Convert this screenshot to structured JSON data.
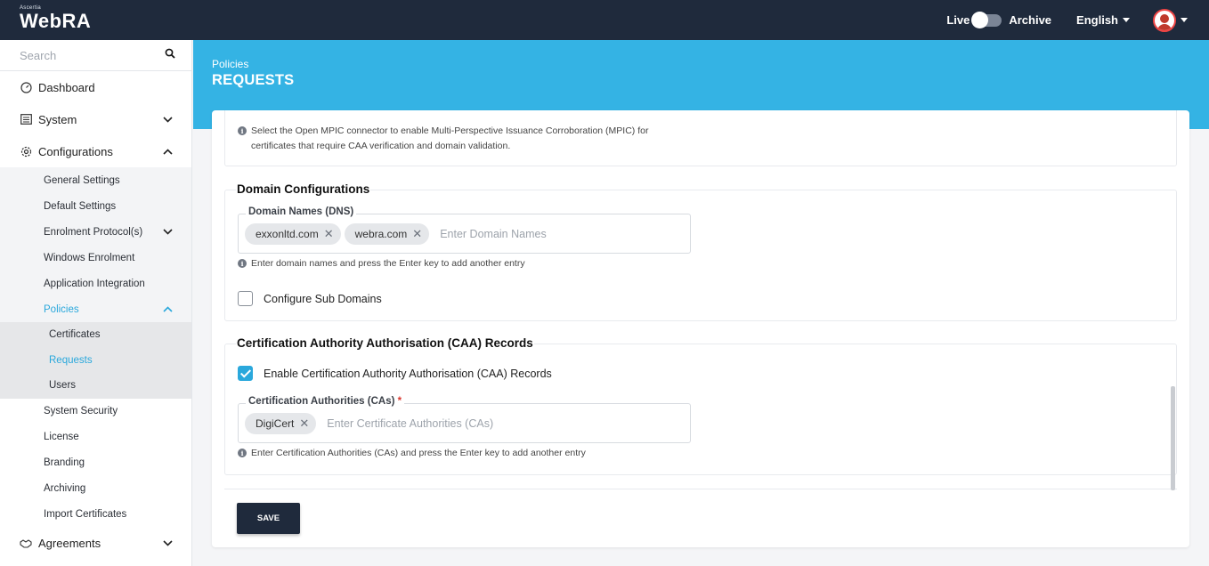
{
  "header": {
    "brand_small": "Ascertia",
    "brand": "WebRA",
    "live_label": "Live",
    "archive_label": "Archive",
    "language": "English"
  },
  "sidebar": {
    "search_placeholder": "Search",
    "dashboard": "Dashboard",
    "system": "System",
    "configurations": "Configurations",
    "config_items": {
      "general": "General Settings",
      "default": "Default Settings",
      "enrolment": "Enrolment Protocol(s)",
      "windows": "Windows Enrolment",
      "app_integration": "Application Integration",
      "policies": "Policies",
      "system_security": "System Security",
      "license": "License",
      "branding": "Branding",
      "archiving": "Archiving",
      "import_certs": "Import Certificates"
    },
    "policies_items": {
      "certificates": "Certificates",
      "requests": "Requests",
      "users": "Users"
    },
    "agreements": "Agreements"
  },
  "page": {
    "breadcrumb": "Policies",
    "title": "REQUESTS"
  },
  "mpic": {
    "info_line1": "Select the Open MPIC connector to enable Multi-Perspective Issuance Corroboration (MPIC) for",
    "info_line2": "certificates that require CAA verification and domain validation."
  },
  "domain": {
    "section_title": "Domain Configurations",
    "field_label": "Domain Names (DNS)",
    "chips": [
      "exxonltd.com",
      "webra.com"
    ],
    "placeholder": "Enter Domain Names",
    "hint": "Enter domain names and press the Enter key to add another entry",
    "subdomains_label": "Configure Sub Domains"
  },
  "caa": {
    "section_title": "Certification Authority Authorisation (CAA) Records",
    "enable_label": "Enable Certification Authority Authorisation (CAA) Records",
    "field_label": "Certification Authorities (CAs)",
    "required_mark": "*",
    "chips": [
      "DigiCert"
    ],
    "placeholder": "Enter Certificate Authorities (CAs)",
    "hint": "Enter Certification Authorities (CAs) and press the Enter key to add another entry"
  },
  "actions": {
    "save": "SAVE"
  },
  "colors": {
    "topbar": "#1f2a3c",
    "accent": "#34b3e4",
    "active_link": "#2aa8dc",
    "checkbox": "#2aa8dc"
  }
}
